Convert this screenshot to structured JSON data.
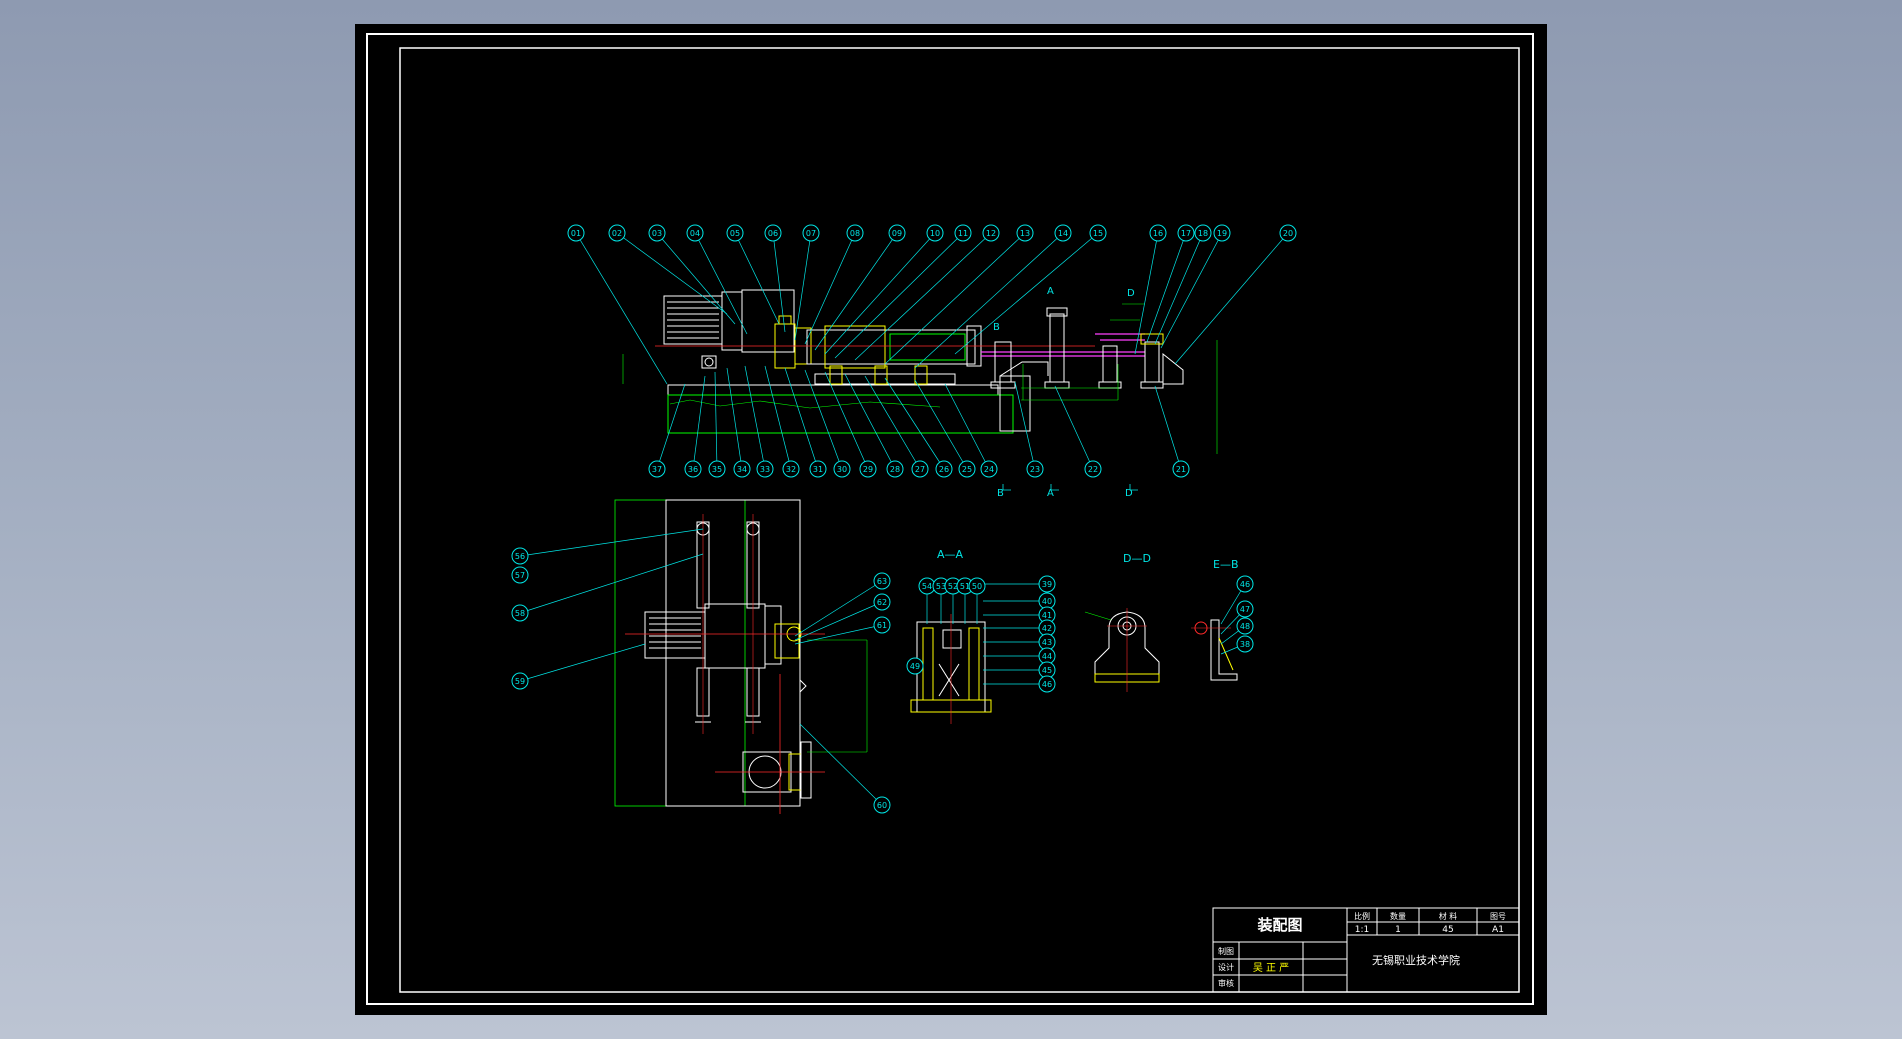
{
  "drawing": {
    "title": "装配图",
    "header_labels": [
      "比例",
      "数量",
      "材 料",
      "图号"
    ],
    "header_values": [
      "1:1",
      "1",
      "45",
      "A1"
    ],
    "row_labels": [
      "制图",
      "设计",
      "审核"
    ],
    "designer": "吴 正 严",
    "institution": "无锡职业技术学院"
  },
  "views": {
    "section_aa": "A—A",
    "section_dd": "D—D",
    "section_eb": "E—B",
    "marker_a": "A",
    "marker_b": "B",
    "marker_d": "D"
  },
  "balloons_top": [
    "01",
    "02",
    "03",
    "04",
    "05",
    "06",
    "07",
    "08",
    "09",
    "10",
    "11",
    "12",
    "13",
    "14",
    "15",
    "16",
    "17",
    "18",
    "19",
    "20"
  ],
  "balloons_bottom": [
    "37",
    "36",
    "35",
    "34",
    "33",
    "32",
    "31",
    "30",
    "29",
    "28",
    "27",
    "26",
    "25",
    "24",
    "23",
    "22",
    "21"
  ],
  "balloons_plan": [
    "56",
    "57",
    "58",
    "59",
    "63",
    "62",
    "61",
    "60"
  ],
  "balloons_aa": [
    "54",
    "53",
    "52",
    "51",
    "50",
    "39",
    "40",
    "41",
    "42",
    "43",
    "44",
    "45",
    "46",
    "49"
  ],
  "balloons_eb": [
    "46",
    "47",
    "48",
    "38"
  ],
  "colors": {
    "sheet": "#000000",
    "border": "#ffffff",
    "balloon": "#00e5e5",
    "leader": "#00e5e5",
    "part": "#ffffff",
    "centerline": "#ff2a2a",
    "dimension": "#00ff00",
    "hatch": "#ffff00",
    "shaft": "#ff40ff"
  }
}
